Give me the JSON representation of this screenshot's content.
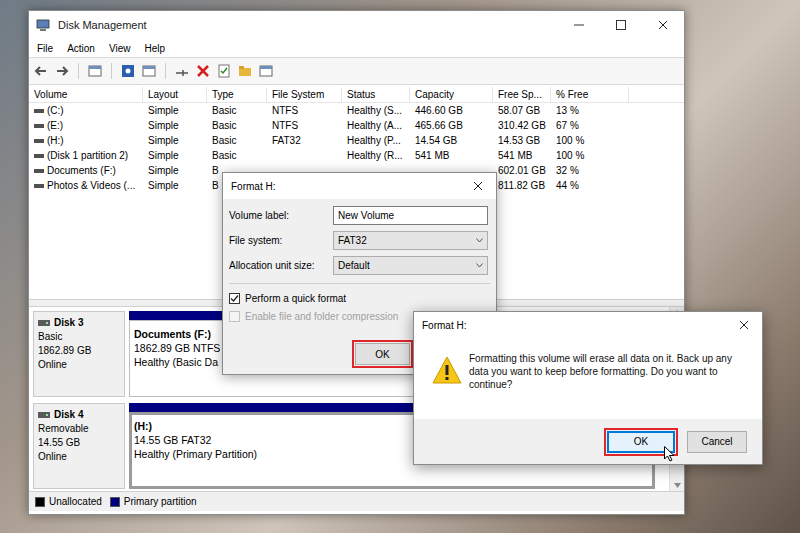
{
  "window": {
    "title": "Disk Management"
  },
  "menu": [
    {
      "label": "File"
    },
    {
      "label": "Action"
    },
    {
      "label": "View"
    },
    {
      "label": "Help"
    }
  ],
  "volumes": {
    "columns": [
      "Volume",
      "Layout",
      "Type",
      "File System",
      "Status",
      "Capacity",
      "Free Sp...",
      "% Free"
    ],
    "rows": [
      {
        "cells": [
          "(C:)",
          "Simple",
          "Basic",
          "NTFS",
          "Healthy (S...",
          "446.60 GB",
          "58.07 GB",
          "13 %"
        ]
      },
      {
        "cells": [
          "(E:)",
          "Simple",
          "Basic",
          "NTFS",
          "Healthy (A...",
          "465.66 GB",
          "310.42 GB",
          "67 %"
        ]
      },
      {
        "cells": [
          "(H:)",
          "Simple",
          "Basic",
          "FAT32",
          "Healthy (P...",
          "14.54 GB",
          "14.53 GB",
          "100 %"
        ]
      },
      {
        "cells": [
          "(Disk 1 partition 2)",
          "Simple",
          "Basic",
          "",
          "Healthy (R...",
          "541 MB",
          "541 MB",
          "100 %"
        ]
      },
      {
        "cells": [
          "Documents (F:)",
          "Simple",
          "B",
          "",
          "",
          "",
          "602.01 GB",
          "32 %"
        ]
      },
      {
        "cells": [
          "Photos & Videos (...",
          "Simple",
          "B",
          "",
          "",
          "",
          "811.82 GB",
          "44 %"
        ]
      }
    ]
  },
  "disks": [
    {
      "name": "Disk 3",
      "type": "Basic",
      "size": "1862.89 GB",
      "status": "Online",
      "partition": {
        "name": "Documents (F:)",
        "info": "1862.89 GB NTFS",
        "status": "Healthy (Basic Da",
        "selected": false
      }
    },
    {
      "name": "Disk 4",
      "type": "Removable",
      "size": "14.55 GB",
      "status": "Online",
      "partition": {
        "name": "(H:)",
        "info": "14.55 GB FAT32",
        "status": "Healthy (Primary Partition)",
        "selected": true
      }
    }
  ],
  "legend": [
    {
      "label": "Unallocated",
      "color": "#000000"
    },
    {
      "label": "Primary partition",
      "color": "#000080"
    }
  ],
  "format_dialog": {
    "title": "Format H:",
    "fields": [
      {
        "label": "Volume label:",
        "value": "New Volume",
        "kind": "input"
      },
      {
        "label": "File system:",
        "value": "FAT32",
        "kind": "select"
      },
      {
        "label": "Allocation unit size:",
        "value": "Default",
        "kind": "select"
      }
    ],
    "checkboxes": [
      {
        "label": "Perform a quick format",
        "checked": true,
        "disabled": false
      },
      {
        "label": "Enable file and folder compression",
        "checked": false,
        "disabled": true
      }
    ],
    "buttons": [
      {
        "label": "OK",
        "highlighted": true
      }
    ]
  },
  "confirm_dialog": {
    "title": "Format H:",
    "message": "Formatting this volume will erase all data on it. Back up any data you want to keep before formatting. Do you want to continue?",
    "buttons": [
      {
        "label": "OK",
        "default": true,
        "highlighted": true
      },
      {
        "label": "Cancel",
        "default": false,
        "highlighted": false
      }
    ]
  }
}
